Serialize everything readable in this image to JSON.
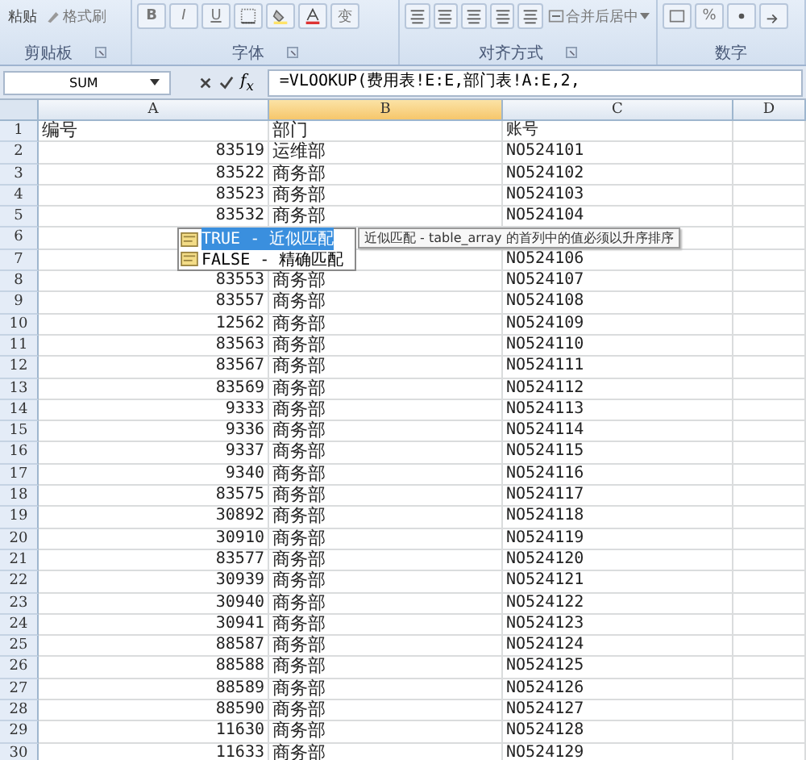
{
  "ribbon": {
    "groups": [
      {
        "label": "剪贴板",
        "launcher": true,
        "items": [
          {
            "kind": "paste",
            "label": "粘贴"
          },
          {
            "kind": "painter",
            "label": "格式刷"
          }
        ]
      },
      {
        "label": "字体",
        "launcher": true,
        "items": [
          {
            "kind": "bold",
            "label": "B"
          },
          {
            "kind": "italic",
            "label": "I"
          },
          {
            "kind": "underline",
            "label": "U"
          },
          {
            "kind": "border"
          },
          {
            "kind": "fill"
          },
          {
            "kind": "font_color"
          },
          {
            "kind": "text",
            "label": "变"
          }
        ]
      },
      {
        "label": "对齐方式",
        "launcher": true,
        "items": [
          {
            "kind": "align_left"
          },
          {
            "kind": "align_center"
          },
          {
            "kind": "align_right"
          },
          {
            "kind": "outdent"
          },
          {
            "kind": "indent"
          },
          {
            "kind": "merge",
            "label": "合并后居中"
          }
        ]
      },
      {
        "label": "数字",
        "launcher": false,
        "items": [
          {
            "kind": "number_format"
          },
          {
            "kind": "text",
            "label": "%"
          },
          {
            "kind": "comma"
          },
          {
            "kind": "increase_decimal"
          }
        ]
      }
    ]
  },
  "formula_bar": {
    "name_box": "SUM",
    "fx": "f$_{x}$",
    "formula": "=VLOOKUP(费用表!E:E,部门表!A:E,2,"
  },
  "columns": [
    {
      "label": "A",
      "selected": false
    },
    {
      "label": "B",
      "selected": true
    },
    {
      "label": "C",
      "selected": false
    },
    {
      "label": "D",
      "selected": false
    }
  ],
  "rows": [
    {
      "row": "1",
      "kind": "label",
      "num": "编号",
      "dept": "部门",
      "account": "账号"
    },
    {
      "row": "2",
      "kind": "data",
      "num": "83519",
      "dept": "运维部",
      "account": "NO524101"
    },
    {
      "row": "3",
      "kind": "data",
      "num": "83522",
      "dept": "商务部",
      "account": "NO524102"
    },
    {
      "row": "4",
      "kind": "data",
      "num": "83523",
      "dept": "商务部",
      "account": "NO524103"
    },
    {
      "row": "5",
      "kind": "data",
      "num": "83532",
      "dept": "商务部",
      "account": "NO524104"
    },
    {
      "row": "6",
      "kind": "data"
    },
    {
      "row": "7",
      "kind": "data",
      "account": "NO524106"
    },
    {
      "row": "8",
      "kind": "data",
      "num": "83553",
      "dept": "商务部",
      "account": "NO524107"
    },
    {
      "row": "9",
      "kind": "data",
      "num": "83557",
      "dept": "商务部",
      "account": "NO524108"
    },
    {
      "row": "10",
      "kind": "data",
      "num": "12562",
      "dept": "商务部",
      "account": "NO524109"
    },
    {
      "row": "11",
      "kind": "data",
      "num": "83563",
      "dept": "商务部",
      "account": "NO524110"
    },
    {
      "row": "12",
      "kind": "data",
      "num": "83567",
      "dept": "商务部",
      "account": "NO524111"
    },
    {
      "row": "13",
      "kind": "data",
      "num": "83569",
      "dept": "商务部",
      "account": "NO524112"
    },
    {
      "row": "14",
      "kind": "data",
      "num": "9333",
      "dept": "商务部",
      "account": "NO524113"
    },
    {
      "row": "15",
      "kind": "data",
      "num": "9336",
      "dept": "商务部",
      "account": "NO524114"
    },
    {
      "row": "16",
      "kind": "data",
      "num": "9337",
      "dept": "商务部",
      "account": "NO524115"
    },
    {
      "row": "17",
      "kind": "data",
      "num": "9340",
      "dept": "商务部",
      "account": "NO524116"
    },
    {
      "row": "18",
      "kind": "data",
      "num": "83575",
      "dept": "商务部",
      "account": "NO524117"
    },
    {
      "row": "19",
      "kind": "data",
      "num": "30892",
      "dept": "商务部",
      "account": "NO524118"
    },
    {
      "row": "20",
      "kind": "data",
      "num": "30910",
      "dept": "商务部",
      "account": "NO524119"
    },
    {
      "row": "21",
      "kind": "data",
      "num": "83577",
      "dept": "商务部",
      "account": "NO524120"
    },
    {
      "row": "22",
      "kind": "data",
      "num": "30939",
      "dept": "商务部",
      "account": "NO524121"
    },
    {
      "row": "23",
      "kind": "data",
      "num": "30940",
      "dept": "商务部",
      "account": "NO524122"
    },
    {
      "row": "24",
      "kind": "data",
      "num": "30941",
      "dept": "商务部",
      "account": "NO524123"
    },
    {
      "row": "25",
      "kind": "data",
      "num": "88587",
      "dept": "商务部",
      "account": "NO524124"
    },
    {
      "row": "26",
      "kind": "data",
      "num": "88588",
      "dept": "商务部",
      "account": "NO524125"
    },
    {
      "row": "27",
      "kind": "data",
      "num": "88589",
      "dept": "商务部",
      "account": "NO524126"
    },
    {
      "row": "28",
      "kind": "data",
      "num": "88590",
      "dept": "商务部",
      "account": "NO524127"
    },
    {
      "row": "29",
      "kind": "data",
      "num": "11630",
      "dept": "商务部",
      "account": "NO524128"
    },
    {
      "row": "30",
      "kind": "data",
      "num": "11633",
      "dept": "商务部",
      "account": "NO524129"
    }
  ],
  "autocomplete": {
    "options": [
      {
        "label": "TRUE - 近似匹配",
        "selected": true
      },
      {
        "label": "FALSE - 精确匹配",
        "selected": false
      }
    ],
    "tooltip": "近似匹配 - table_array 的首列中的值必须以升序排序"
  }
}
